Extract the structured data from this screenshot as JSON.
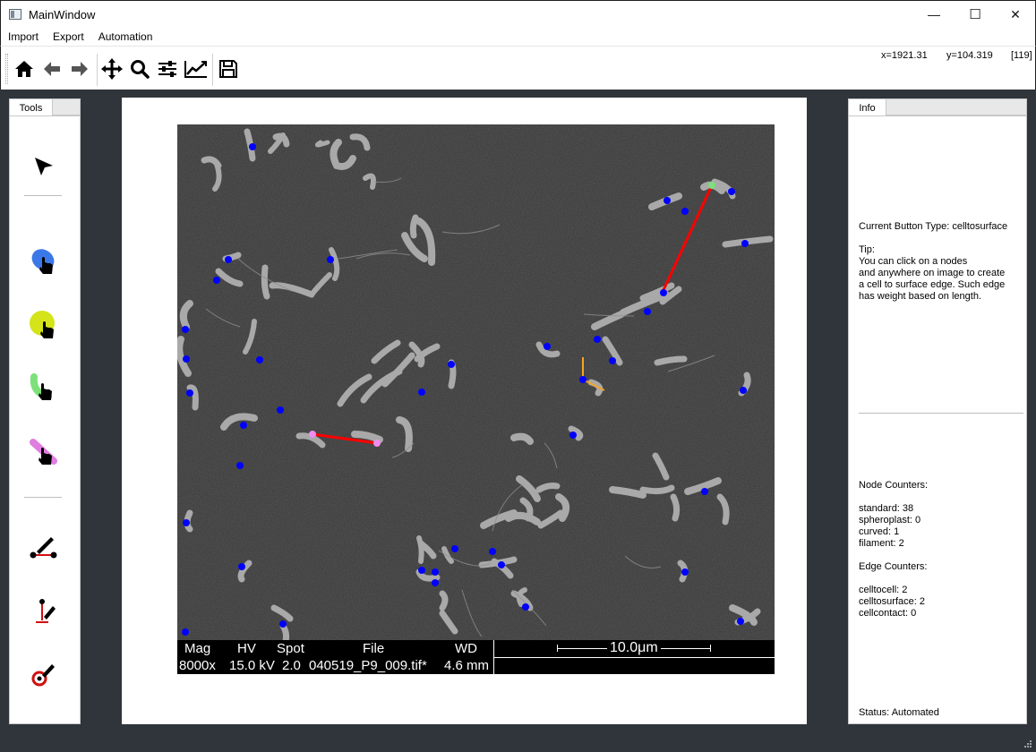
{
  "window": {
    "title": "MainWindow",
    "minimize_glyph": "—",
    "maximize_glyph": "☐",
    "close_glyph": "✕"
  },
  "menu": {
    "items": [
      {
        "label": "Import"
      },
      {
        "label": "Export"
      },
      {
        "label": "Automation"
      }
    ]
  },
  "toolbar": {
    "buttons": [
      "home-icon",
      "back-arrow-icon",
      "forward-arrow-icon",
      "pan-icon",
      "zoom-icon",
      "configure-subplots-icon",
      "edit-axis-icon",
      "save-icon"
    ],
    "coord_x": "x=1921.31",
    "coord_y": "y=104.319",
    "pixel_value": "[119]"
  },
  "tools": {
    "tab_label": "Tools",
    "buttons": [
      {
        "name": "select-pointer-icon"
      },
      {
        "name": "standard-node-tool-icon",
        "color": "#3b78e7"
      },
      {
        "name": "spheroplast-node-tool-icon",
        "color": "#d4e31a"
      },
      {
        "name": "curved-node-tool-icon",
        "color": "#7ee07a"
      },
      {
        "name": "filament-node-tool-icon",
        "color": "#e07ee0"
      },
      {
        "name": "cell-to-cell-edge-tool-icon"
      },
      {
        "name": "cell-to-surface-edge-tool-icon"
      },
      {
        "name": "cell-contact-tool-icon"
      }
    ]
  },
  "image": {
    "scale_bar_text": "10.0μm",
    "meta_labels": [
      "Mag",
      "HV",
      "Spot",
      "File",
      "WD"
    ],
    "meta_values": [
      "8000x",
      "15.0 kV",
      "2.0",
      "040519_P9_009.tif*",
      "4.6 mm"
    ],
    "node_colors": {
      "standard": "#0000ff",
      "curved": "#7be07b",
      "filament": "#f08cf0"
    },
    "edge_colors": {
      "celltosurface": "#ff0000",
      "celltocell": "#ff0000",
      "selection": "#f5a623"
    }
  },
  "info": {
    "tab_label": "Info",
    "current_type": "Current Button Type: celltosurface",
    "tip": "Tip:\nYou can click on a nodes\nand anywhere on image to create\na cell to surface edge. Such edge\nhas weight based on length.",
    "node_counters_title": "Node Counters:",
    "node_counters": "standard: 38\nspheroplast: 0\ncurved: 1\nfilament: 2",
    "edge_counters_title": "Edge Counters:",
    "edge_counters": "celltocell: 2\ncelltosurface: 2\ncellcontact: 0",
    "status": "Status: Automated"
  }
}
